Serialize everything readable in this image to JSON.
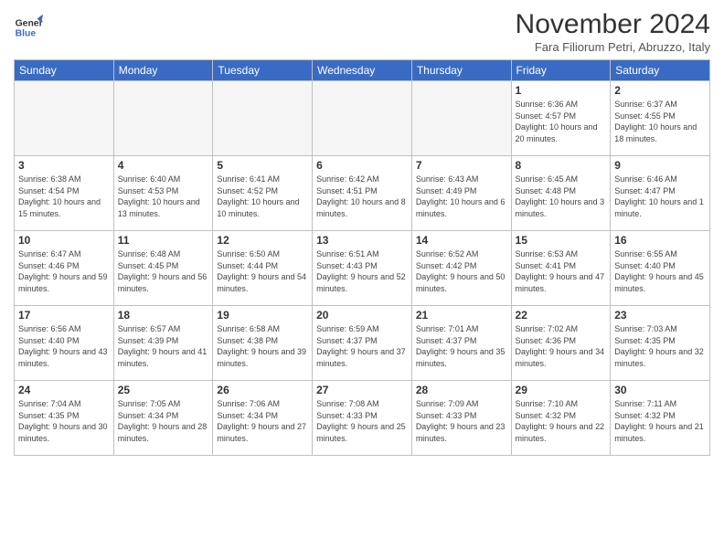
{
  "header": {
    "logo_line1": "General",
    "logo_line2": "Blue",
    "month_title": "November 2024",
    "subtitle": "Fara Filiorum Petri, Abruzzo, Italy"
  },
  "weekdays": [
    "Sunday",
    "Monday",
    "Tuesday",
    "Wednesday",
    "Thursday",
    "Friday",
    "Saturday"
  ],
  "weeks": [
    [
      {
        "day": "",
        "info": ""
      },
      {
        "day": "",
        "info": ""
      },
      {
        "day": "",
        "info": ""
      },
      {
        "day": "",
        "info": ""
      },
      {
        "day": "",
        "info": ""
      },
      {
        "day": "1",
        "info": "Sunrise: 6:36 AM\nSunset: 4:57 PM\nDaylight: 10 hours and 20 minutes."
      },
      {
        "day": "2",
        "info": "Sunrise: 6:37 AM\nSunset: 4:55 PM\nDaylight: 10 hours and 18 minutes."
      }
    ],
    [
      {
        "day": "3",
        "info": "Sunrise: 6:38 AM\nSunset: 4:54 PM\nDaylight: 10 hours and 15 minutes."
      },
      {
        "day": "4",
        "info": "Sunrise: 6:40 AM\nSunset: 4:53 PM\nDaylight: 10 hours and 13 minutes."
      },
      {
        "day": "5",
        "info": "Sunrise: 6:41 AM\nSunset: 4:52 PM\nDaylight: 10 hours and 10 minutes."
      },
      {
        "day": "6",
        "info": "Sunrise: 6:42 AM\nSunset: 4:51 PM\nDaylight: 10 hours and 8 minutes."
      },
      {
        "day": "7",
        "info": "Sunrise: 6:43 AM\nSunset: 4:49 PM\nDaylight: 10 hours and 6 minutes."
      },
      {
        "day": "8",
        "info": "Sunrise: 6:45 AM\nSunset: 4:48 PM\nDaylight: 10 hours and 3 minutes."
      },
      {
        "day": "9",
        "info": "Sunrise: 6:46 AM\nSunset: 4:47 PM\nDaylight: 10 hours and 1 minute."
      }
    ],
    [
      {
        "day": "10",
        "info": "Sunrise: 6:47 AM\nSunset: 4:46 PM\nDaylight: 9 hours and 59 minutes."
      },
      {
        "day": "11",
        "info": "Sunrise: 6:48 AM\nSunset: 4:45 PM\nDaylight: 9 hours and 56 minutes."
      },
      {
        "day": "12",
        "info": "Sunrise: 6:50 AM\nSunset: 4:44 PM\nDaylight: 9 hours and 54 minutes."
      },
      {
        "day": "13",
        "info": "Sunrise: 6:51 AM\nSunset: 4:43 PM\nDaylight: 9 hours and 52 minutes."
      },
      {
        "day": "14",
        "info": "Sunrise: 6:52 AM\nSunset: 4:42 PM\nDaylight: 9 hours and 50 minutes."
      },
      {
        "day": "15",
        "info": "Sunrise: 6:53 AM\nSunset: 4:41 PM\nDaylight: 9 hours and 47 minutes."
      },
      {
        "day": "16",
        "info": "Sunrise: 6:55 AM\nSunset: 4:40 PM\nDaylight: 9 hours and 45 minutes."
      }
    ],
    [
      {
        "day": "17",
        "info": "Sunrise: 6:56 AM\nSunset: 4:40 PM\nDaylight: 9 hours and 43 minutes."
      },
      {
        "day": "18",
        "info": "Sunrise: 6:57 AM\nSunset: 4:39 PM\nDaylight: 9 hours and 41 minutes."
      },
      {
        "day": "19",
        "info": "Sunrise: 6:58 AM\nSunset: 4:38 PM\nDaylight: 9 hours and 39 minutes."
      },
      {
        "day": "20",
        "info": "Sunrise: 6:59 AM\nSunset: 4:37 PM\nDaylight: 9 hours and 37 minutes."
      },
      {
        "day": "21",
        "info": "Sunrise: 7:01 AM\nSunset: 4:37 PM\nDaylight: 9 hours and 35 minutes."
      },
      {
        "day": "22",
        "info": "Sunrise: 7:02 AM\nSunset: 4:36 PM\nDaylight: 9 hours and 34 minutes."
      },
      {
        "day": "23",
        "info": "Sunrise: 7:03 AM\nSunset: 4:35 PM\nDaylight: 9 hours and 32 minutes."
      }
    ],
    [
      {
        "day": "24",
        "info": "Sunrise: 7:04 AM\nSunset: 4:35 PM\nDaylight: 9 hours and 30 minutes."
      },
      {
        "day": "25",
        "info": "Sunrise: 7:05 AM\nSunset: 4:34 PM\nDaylight: 9 hours and 28 minutes."
      },
      {
        "day": "26",
        "info": "Sunrise: 7:06 AM\nSunset: 4:34 PM\nDaylight: 9 hours and 27 minutes."
      },
      {
        "day": "27",
        "info": "Sunrise: 7:08 AM\nSunset: 4:33 PM\nDaylight: 9 hours and 25 minutes."
      },
      {
        "day": "28",
        "info": "Sunrise: 7:09 AM\nSunset: 4:33 PM\nDaylight: 9 hours and 23 minutes."
      },
      {
        "day": "29",
        "info": "Sunrise: 7:10 AM\nSunset: 4:32 PM\nDaylight: 9 hours and 22 minutes."
      },
      {
        "day": "30",
        "info": "Sunrise: 7:11 AM\nSunset: 4:32 PM\nDaylight: 9 hours and 21 minutes."
      }
    ]
  ]
}
